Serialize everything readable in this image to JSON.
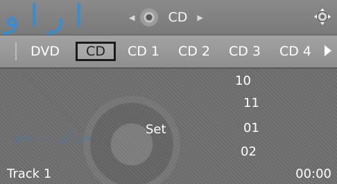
{
  "header": {
    "source_title": "CD",
    "nav_left_icon": "triangle-left",
    "nav_right_icon": "triangle-right",
    "disc_icon": "disc-icon",
    "controller_icon": "joystick-icon",
    "ghost_logo": "ا ر ا و"
  },
  "tabs": [
    {
      "label": "DVD",
      "active": false
    },
    {
      "label": "CD",
      "active": true
    },
    {
      "label": "CD 1",
      "active": false
    },
    {
      "label": "CD 2",
      "active": false
    },
    {
      "label": "CD 3",
      "active": false
    },
    {
      "label": "CD 4",
      "active": false
    }
  ],
  "main": {
    "set_label": "Set",
    "numbers": [
      "10",
      "11",
      "01",
      "02"
    ],
    "ghost_text": "مرکز ... شو"
  },
  "status": {
    "track": "Track 1",
    "time": "00:00"
  }
}
